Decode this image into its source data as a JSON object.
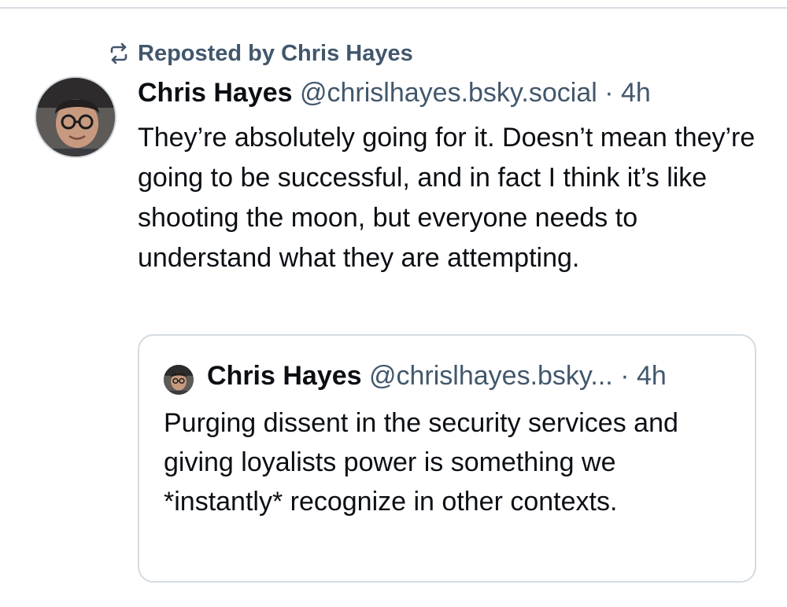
{
  "repost": {
    "icon": "repost-icon",
    "label": "Reposted by Chris Hayes"
  },
  "post": {
    "avatar_icon": "avatar",
    "display_name": "Chris Hayes",
    "handle": "@chrislhayes.bsky.social",
    "separator": " · ",
    "time": "4h",
    "text": "They’re absolutely going for it. Doesn’t mean they’re going to be successful, and in fact I think it’s like shooting the moon, but everyone needs to understand what they are attempting."
  },
  "quote": {
    "avatar_icon": "avatar",
    "display_name": "Chris Hayes",
    "handle": "@chrislhayes.bsky...",
    "separator": " · ",
    "time": "4h",
    "text": "Purging dissent in the security services and giving loyalists power is something we *instantly* recognize in other contexts."
  },
  "colors": {
    "text_primary": "#0b0f14",
    "text_secondary": "#42576c",
    "border": "#d4dbe2"
  }
}
